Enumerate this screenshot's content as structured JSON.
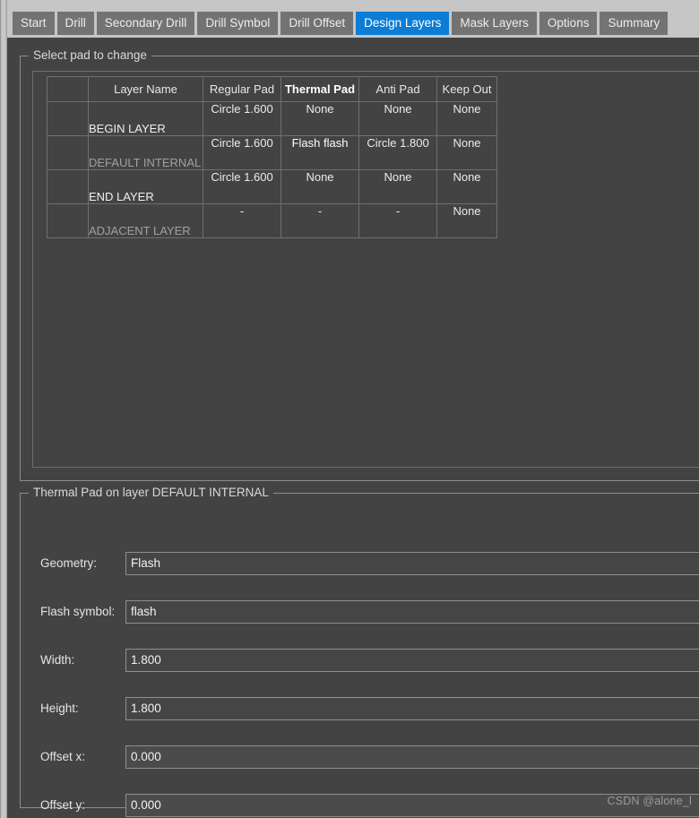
{
  "window": {
    "title": "Design Layers"
  },
  "tabs": [
    {
      "label": "Start",
      "active": false
    },
    {
      "label": "Drill",
      "active": false
    },
    {
      "label": "Secondary Drill",
      "active": false
    },
    {
      "label": "Drill Symbol",
      "active": false
    },
    {
      "label": "Drill Offset",
      "active": false
    },
    {
      "label": "Design Layers",
      "active": true
    },
    {
      "label": "Mask Layers",
      "active": false
    },
    {
      "label": "Options",
      "active": false
    },
    {
      "label": "Summary",
      "active": false
    }
  ],
  "select_pad_group": {
    "title": "Select pad to change",
    "table": {
      "columns": [
        "",
        "Layer Name",
        "Regular Pad",
        "Thermal Pad",
        "Anti Pad",
        "Keep Out"
      ],
      "emphasized_column": "Thermal Pad",
      "rows": [
        {
          "select": "",
          "layer_name": "BEGIN LAYER",
          "dim_name": false,
          "regular_pad": "Circle 1.600",
          "thermal_pad": "None",
          "anti_pad": "None",
          "keep_out": "None",
          "selected_cell": ""
        },
        {
          "select": "",
          "layer_name": "DEFAULT INTERNAL",
          "dim_name": true,
          "regular_pad": "Circle 1.600",
          "thermal_pad": "Flash flash",
          "anti_pad": "Circle 1.800",
          "keep_out": "None",
          "selected_cell": "thermal_pad"
        },
        {
          "select": "",
          "layer_name": "END LAYER",
          "dim_name": false,
          "regular_pad": "Circle 1.600",
          "thermal_pad": "None",
          "anti_pad": "None",
          "keep_out": "None",
          "selected_cell": ""
        },
        {
          "select": "",
          "layer_name": "ADJACENT LAYER",
          "dim_name": true,
          "regular_pad": "-",
          "thermal_pad": "-",
          "anti_pad": "-",
          "keep_out": "None",
          "selected_cell": ""
        }
      ]
    }
  },
  "thermal_group": {
    "title": "Thermal Pad on layer DEFAULT INTERNAL",
    "fields": [
      {
        "label": "Geometry:",
        "value": "Flash",
        "readonly": false
      },
      {
        "label": "Flash symbol:",
        "value": "flash",
        "readonly": false
      },
      {
        "label": "Width:",
        "value": "1.800",
        "readonly": false
      },
      {
        "label": "Height:",
        "value": "1.800",
        "readonly": false
      },
      {
        "label": "Offset x:",
        "value": "0.000",
        "readonly": true
      },
      {
        "label": "Offset y:",
        "value": "0.000",
        "readonly": true
      }
    ]
  },
  "watermark": {
    "text": "CSDN @alone_l"
  },
  "colors": {
    "accent_blue": "#0c7cd5",
    "window_bg": "#434343",
    "tabbar_bg": "#c6c6c6",
    "tab_bg": "#737373",
    "border": "#8d8d8d",
    "grid_line": "#6f6f6f",
    "text": "#e4e4e4",
    "text_dim": "#a0a0a0"
  }
}
